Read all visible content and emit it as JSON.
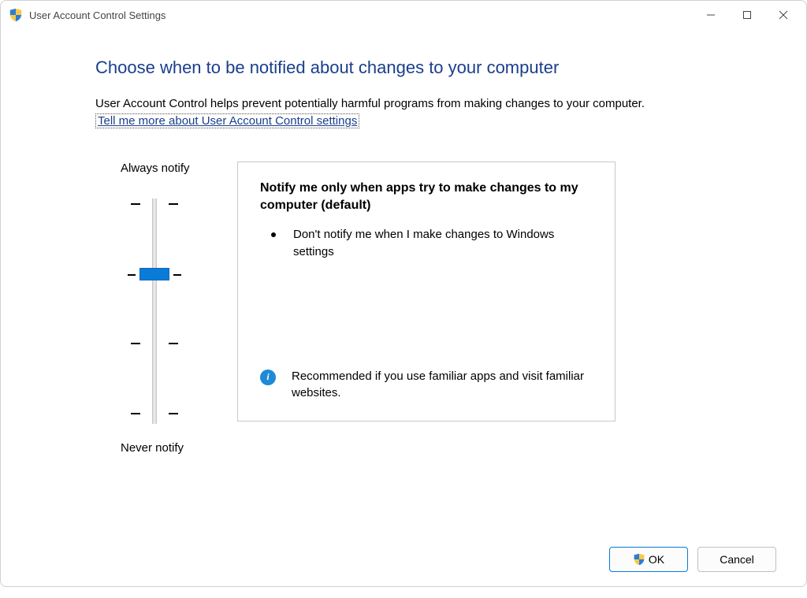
{
  "window": {
    "title": "User Account Control Settings"
  },
  "content": {
    "heading": "Choose when to be notified about changes to your computer",
    "intro": "User Account Control helps prevent potentially harmful programs from making changes to your computer.",
    "help_link": "Tell me more about User Account Control settings"
  },
  "slider": {
    "top_label": "Always notify",
    "bottom_label": "Never notify",
    "levels": 4,
    "selected_index": 1
  },
  "description": {
    "title": "Notify me only when apps try to make changes to my computer (default)",
    "bullet": "Don't notify me when I make changes to Windows settings",
    "recommendation": "Recommended if you use familiar apps and visit familiar websites."
  },
  "footer": {
    "ok_label": "OK",
    "cancel_label": "Cancel"
  }
}
